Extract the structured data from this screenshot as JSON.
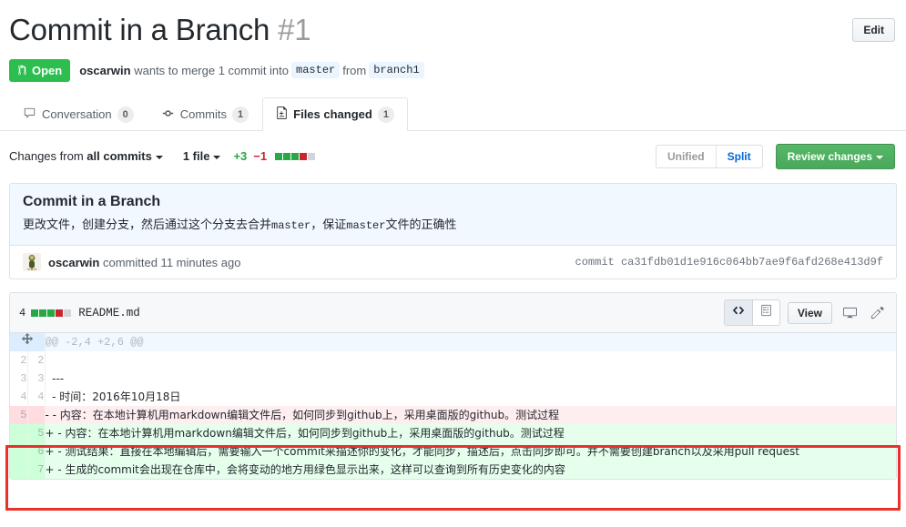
{
  "header": {
    "title": "Commit in a Branch",
    "number": "#1",
    "edit_label": "Edit",
    "state": "Open",
    "author": "oscarwin",
    "merge_text_1": "wants to merge 1 commit into",
    "base_branch": "master",
    "merge_text_2": "from",
    "head_branch": "branch1"
  },
  "tabs": [
    {
      "label": "Conversation",
      "count": "0",
      "icon": "comment-discussion-icon",
      "selected": false
    },
    {
      "label": "Commits",
      "count": "1",
      "icon": "git-commit-icon",
      "selected": false
    },
    {
      "label": "Files changed",
      "count": "1",
      "icon": "diff-file-icon",
      "selected": true
    }
  ],
  "toolbar": {
    "changes_from_prefix": "Changes from",
    "changes_from_value": "all commits",
    "file_filter": "1 file",
    "additions": "+3",
    "deletions": "−1",
    "stat_blocks": [
      "g",
      "g",
      "g",
      "r",
      "n"
    ],
    "unified_label": "Unified",
    "split_label": "Split",
    "review_label": "Review changes"
  },
  "commit": {
    "title": "Commit in a Branch",
    "description_parts": [
      {
        "text": "更改文件，创建分支，然后通过这个分支去合并",
        "mono": false
      },
      {
        "text": "master",
        "mono": true
      },
      {
        "text": "，保证",
        "mono": false
      },
      {
        "text": "master",
        "mono": true
      },
      {
        "text": "文件的正确性",
        "mono": false
      }
    ],
    "author": "oscarwin",
    "action_text": "committed 11 minutes ago",
    "sha_label": "commit",
    "sha": "ca31fdb01d1e916c064bb7ae9f6afd268e413d9f"
  },
  "file": {
    "change_count": "4",
    "stat_blocks": [
      "g",
      "g",
      "g",
      "r",
      "n"
    ],
    "name": "README.md",
    "view_label": "View",
    "code_icon": "code-icon",
    "blob_icon": "file-icon",
    "display_icon": "display-icon",
    "edit_icon": "pencil-icon"
  },
  "diff": {
    "hunk_header": "@@ -2,4 +2,6 @@",
    "rows": [
      {
        "type": "context",
        "old": "2",
        "new": "2",
        "text": ""
      },
      {
        "type": "context",
        "old": "3",
        "new": "3",
        "text": "  ---"
      },
      {
        "type": "context",
        "old": "4",
        "new": "4",
        "text": "  - 时间：2016年10月18日"
      },
      {
        "type": "del",
        "old": "5",
        "new": "",
        "text": "- - 内容：在本地计算机用markdown编辑文件后，如何同步到github上，采用桌面版的github。测试过程"
      },
      {
        "type": "add",
        "old": "",
        "new": "5",
        "text": "+ - 内容：在本地计算机用markdown编辑文件后，如何同步到github上，采用桌面版的github。测试过程"
      },
      {
        "type": "add",
        "old": "",
        "new": "6",
        "text": "+ - 测试结果：直接在本地编辑后，需要输入一个commit来描述你的变化，才能同步，描述后，点击同步即可。并不需要创建branch以及采用pull request"
      },
      {
        "type": "add",
        "old": "",
        "new": "7",
        "text": "+ - 生成的commit会出现在仓库中，会将变动的地方用绿色显示出来，这样可以查询到所有历史变化的内容"
      }
    ]
  }
}
